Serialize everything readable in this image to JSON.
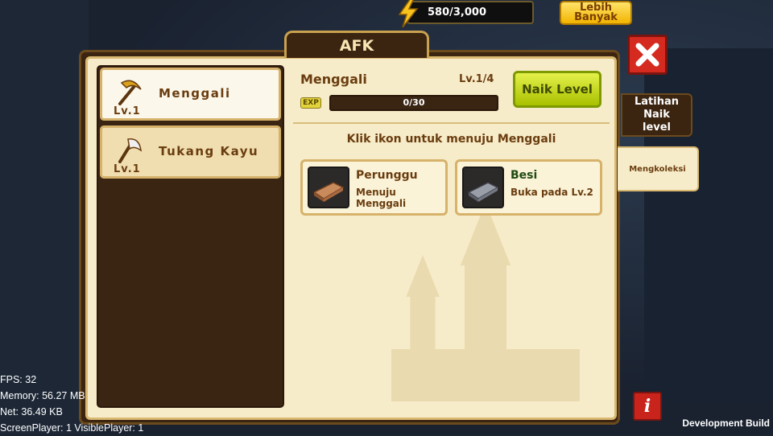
{
  "hud": {
    "energy": "580/3,000",
    "more_button": "Lebih Banyak"
  },
  "window": {
    "title": "AFK",
    "close_icon": "close-x-icon",
    "info_label": "i"
  },
  "jobs": [
    {
      "name": "Menggali",
      "level": "Lv.1",
      "icon": "pickaxe-icon",
      "selected": true
    },
    {
      "name": "Tukang Kayu",
      "level": "Lv.1",
      "icon": "axe-icon",
      "selected": false
    }
  ],
  "detail": {
    "title": "Menggali",
    "level": "Lv.1/4",
    "exp_tag": "EXP",
    "exp_text": "0/30",
    "exp_fraction": 0,
    "level_up_button": "Naik Level",
    "hint": "Klik ikon untuk menuju Menggali"
  },
  "materials": [
    {
      "name": "Perunggu",
      "desc": "Menuju Menggali",
      "icon": "bronze-ingot-icon",
      "name_color": "#6a3d10"
    },
    {
      "name": "Besi",
      "desc": "Buka pada Lv.2",
      "icon": "iron-ingot-icon",
      "name_color": "#1f4a12"
    }
  ],
  "side_tabs": {
    "train": "Latihan Naik level",
    "collect": "Mengkoleksi"
  },
  "debug": {
    "fps": "FPS: 32",
    "memory": "Memory: 56.27 MB",
    "net": "Net: 36.49 KB",
    "players": "ScreenPlayer: 1 VisiblePlayer: 1",
    "build": "Development Build"
  }
}
